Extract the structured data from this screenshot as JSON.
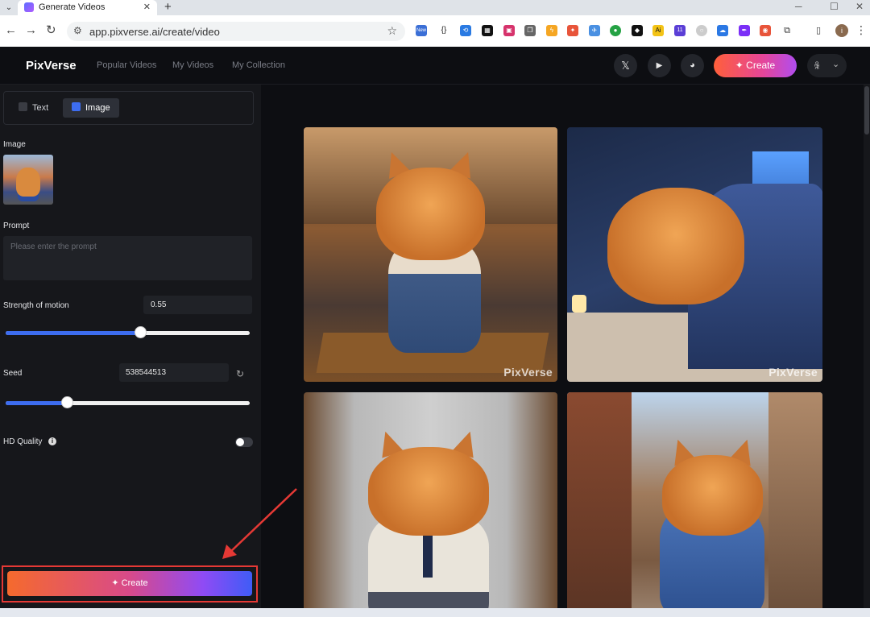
{
  "browser": {
    "tab_title": "Generate Videos",
    "url": "app.pixverse.ai/create/video",
    "ext_new_badge": "New",
    "ext_badge_count": "11",
    "profile_initial": "i"
  },
  "header": {
    "logo": "PixVerse",
    "nav": [
      "Popular Videos",
      "My Videos",
      "My Collection"
    ],
    "create_label": "Create"
  },
  "sidebar": {
    "modes": [
      {
        "label": "Text"
      },
      {
        "label": "Image",
        "active": true
      }
    ],
    "image_label": "Image",
    "prompt_label": "Prompt",
    "prompt_placeholder": "Please enter the prompt",
    "motion_label": "Strength of motion",
    "motion_value": "0.55",
    "motion_fraction": 0.55,
    "seed_label": "Seed",
    "seed_value": "538544513",
    "seed_fraction": 0.25,
    "hd_label": "HD Quality",
    "hd_enabled": false,
    "create_label": "Create"
  },
  "gallery": {
    "watermark": "PixVerse"
  },
  "colors": {
    "accent_blue": "#3d6df0",
    "create_gradient_start": "#f56a2d",
    "create_gradient_end": "#3f5cf6",
    "highlight_red": "#e53935"
  }
}
